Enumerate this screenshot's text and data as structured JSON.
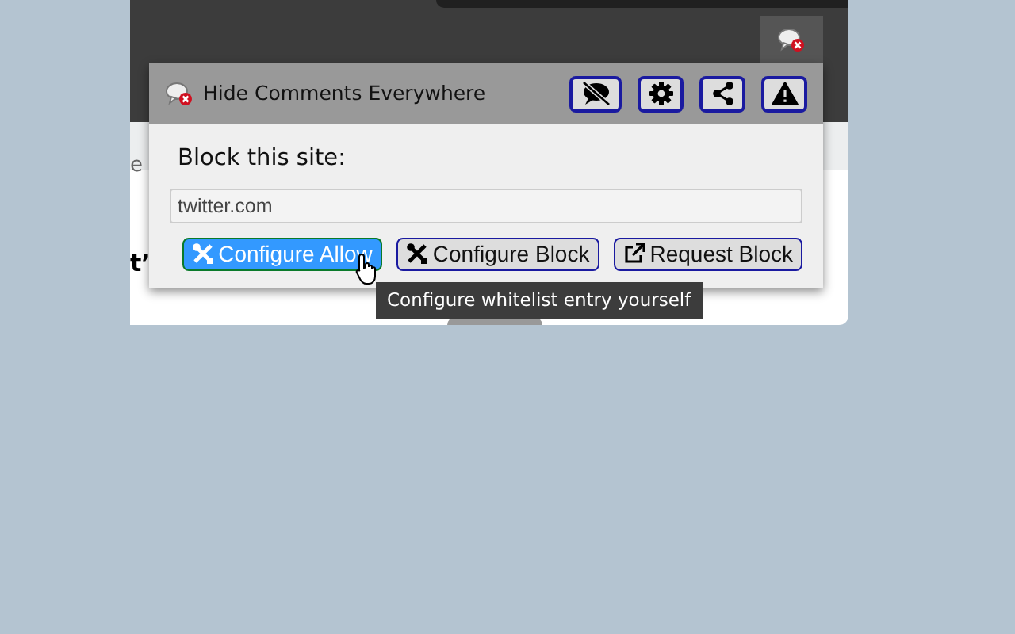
{
  "page_behind": {
    "texts": [
      "e",
      "t’"
    ]
  },
  "popup": {
    "title": "Hide Comments Everywhere",
    "header_buttons": [
      {
        "kind": "hide"
      },
      {
        "kind": "settings"
      },
      {
        "kind": "share"
      },
      {
        "kind": "report"
      }
    ],
    "label": "Block this site:",
    "site_field": {
      "value": "twitter.com"
    },
    "actions": [
      {
        "label": "Configure Allow",
        "kind": "tools",
        "hovered": true
      },
      {
        "label": "Configure Block",
        "kind": "tools",
        "hovered": false
      },
      {
        "label": "Request Block",
        "kind": "external",
        "hovered": false
      }
    ]
  },
  "tooltip": "Configure whitelist entry yourself"
}
